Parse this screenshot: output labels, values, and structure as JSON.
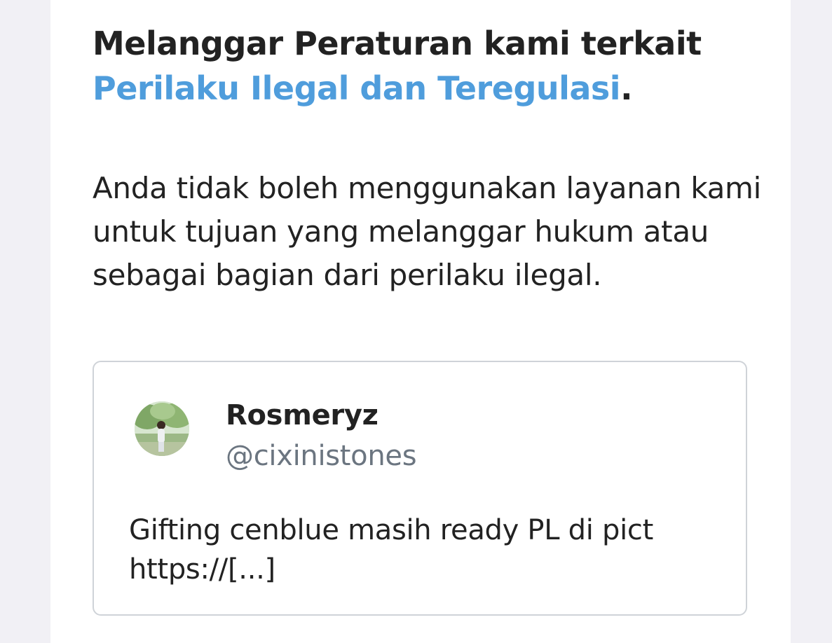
{
  "notice": {
    "heading_prefix": "Melanggar Peraturan kami terkait",
    "heading_link": "Perilaku Ilegal dan Teregulasi",
    "heading_suffix": ".",
    "body": "Anda tidak boleh menggunakan layanan kami untuk tujuan yang melanggar hukum atau sebagai bagian dari perilaku ilegal.",
    "link_color": "#4f9ddc"
  },
  "tweet": {
    "avatar_icon": "user-avatar-photo",
    "display_name": "Rosmeryz",
    "handle": "@cixinistones",
    "text_line1": "Gifting cenblue masih ready PL di pict",
    "text_line2": "https://[...]"
  }
}
